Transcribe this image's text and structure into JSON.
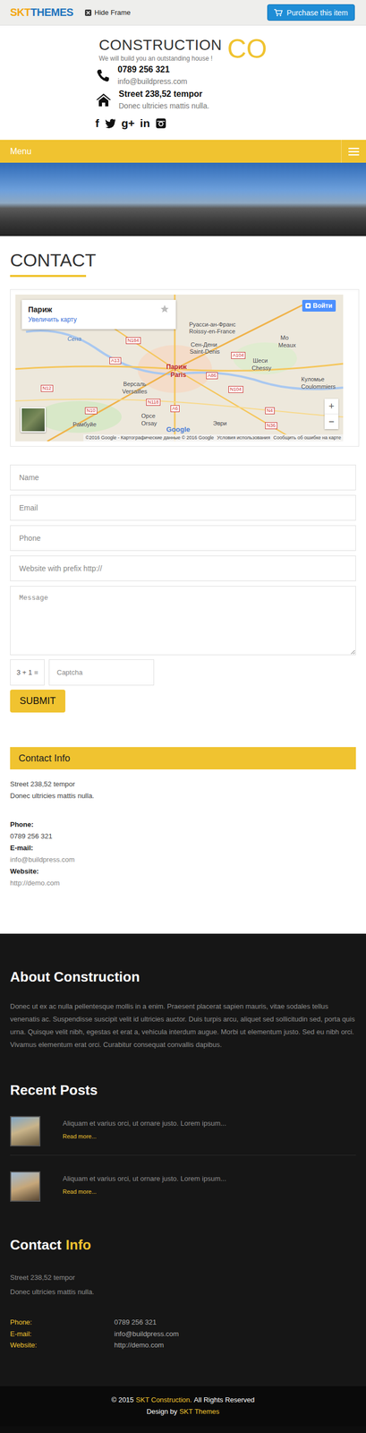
{
  "topbar": {
    "logo_first": "SKT",
    "logo_second": "THEMES",
    "hide_frame": "Hide Frame",
    "purchase": "Purchase this item"
  },
  "header": {
    "title": "CONSTRUCTION",
    "title_accent": "CO",
    "tagline": "We will build you an outstanding house !",
    "phone": "0789 256 321",
    "email": "info@buildpress.com",
    "address": "Street 238,52 tempor",
    "address_note": "Donec ultricies mattis nulla.",
    "social": [
      {
        "kind": "letter",
        "text": "f"
      },
      {
        "kind": "bird",
        "text": ""
      },
      {
        "kind": "letter",
        "text": "g+"
      },
      {
        "kind": "letter",
        "text": "in"
      },
      {
        "kind": "camera",
        "text": ""
      }
    ]
  },
  "menu": {
    "label": "Menu"
  },
  "page": {
    "title": "CONTACT"
  },
  "map": {
    "place": "Париж",
    "enlarge": "Увеличить карту",
    "signin": "Войти",
    "zoom_in": "+",
    "zoom_out": "−",
    "google": "Google",
    "attribution": "©2016 Google - Картографические данные © 2016 Google",
    "terms": "Условия использования",
    "report": "Сообщить об ошибке на карте",
    "labels": [
      {
        "text": "Сена",
        "kind": "river"
      },
      {
        "text": "Руасси-ан-Франс",
        "kind": "city"
      },
      {
        "text": "Roissy-en-France",
        "kind": "city"
      },
      {
        "text": "Сен-Дени",
        "kind": "city"
      },
      {
        "text": "Saint-Denis",
        "kind": "city"
      },
      {
        "text": "Париж",
        "kind": "capital"
      },
      {
        "text": "Paris",
        "kind": "capital"
      },
      {
        "text": "Версаль",
        "kind": "city"
      },
      {
        "text": "Versailles",
        "kind": "city"
      },
      {
        "text": "Мо",
        "kind": "city"
      },
      {
        "text": "Meaux",
        "kind": "city"
      },
      {
        "text": "Шеси",
        "kind": "city"
      },
      {
        "text": "Chessy",
        "kind": "city"
      },
      {
        "text": "Куломье",
        "kind": "city"
      },
      {
        "text": "Coulommiers",
        "kind": "city"
      },
      {
        "text": "Орсе",
        "kind": "city"
      },
      {
        "text": "Orsay",
        "kind": "city"
      },
      {
        "text": "Эври",
        "kind": "city"
      },
      {
        "text": "Рамбуйе",
        "kind": "city"
      },
      {
        "text": "N184",
        "kind": "road"
      },
      {
        "text": "A13",
        "kind": "road"
      },
      {
        "text": "A104",
        "kind": "road"
      },
      {
        "text": "N12",
        "kind": "road"
      },
      {
        "text": "N10",
        "kind": "road"
      },
      {
        "text": "N118",
        "kind": "road"
      },
      {
        "text": "A86",
        "kind": "road"
      },
      {
        "text": "A6",
        "kind": "road"
      },
      {
        "text": "N104",
        "kind": "road"
      },
      {
        "text": "N4",
        "kind": "road"
      },
      {
        "text": "N36",
        "kind": "road"
      }
    ]
  },
  "form": {
    "fields": [
      {
        "placeholder": "Name",
        "kind": "input"
      },
      {
        "placeholder": "Email",
        "kind": "input"
      },
      {
        "placeholder": "Phone",
        "kind": "input"
      },
      {
        "placeholder": "Website with prefix http://",
        "kind": "input"
      },
      {
        "placeholder": "Message",
        "kind": "textarea"
      }
    ],
    "captcha_question": "3 + 1 =",
    "captcha_placeholder": "Captcha",
    "submit": "SUBMIT"
  },
  "contact_info": {
    "title": "Contact Info",
    "address": "Street 238,52 tempor",
    "address_note": "Donec ultricies mattis nulla.",
    "items": [
      {
        "label": "Phone:",
        "value": "0789 256 321",
        "kind": "plain"
      },
      {
        "label": "E-mail:",
        "value": "info@buildpress.com",
        "kind": "link"
      },
      {
        "label": "Website:",
        "value": "http://demo.com",
        "kind": "link"
      }
    ]
  },
  "footer": {
    "about_title": "About Construction",
    "about_text": "Donec ut ex ac nulla pellentesque mollis in a enim. Praesent placerat sapien mauris, vitae sodales tellus venenatis ac. Suspendisse suscipit velit id ultricies auctor. Duis turpis arcu, aliquet sed sollicitudin sed, porta quis urna. Quisque velit nibh, egestas et erat a, vehicula interdum augue. Morbi ut elementum justo. Sed eu nibh orci. Vivamus elementum erat orci. Curabitur consequat convallis dapibus.",
    "recent_title": "Recent Posts",
    "posts": [
      {
        "excerpt": "Aliquam et varius orci, ut ornare justo. Lorem ipsum...",
        "more": "Read more..."
      },
      {
        "excerpt": "Aliquam et varius orci, ut ornare justo. Lorem ipsum...",
        "more": "Read more..."
      }
    ],
    "contact_title": "Contact",
    "contact_accent": "Info",
    "address": "Street 238,52 tempor",
    "address_note": "Donec ultricies mattis nulla.",
    "items": [
      {
        "label": "Phone:",
        "value": "0789 256 321"
      },
      {
        "label": "E-mail:",
        "value": "info@buildpress.com"
      },
      {
        "label": "Website:",
        "value": "http://demo.com"
      }
    ]
  },
  "bottom": {
    "copyright": "© 2015",
    "brand": "SKT Construction.",
    "rights": "All Rights Reserved",
    "design": "Design by",
    "designer": "SKT Themes"
  }
}
